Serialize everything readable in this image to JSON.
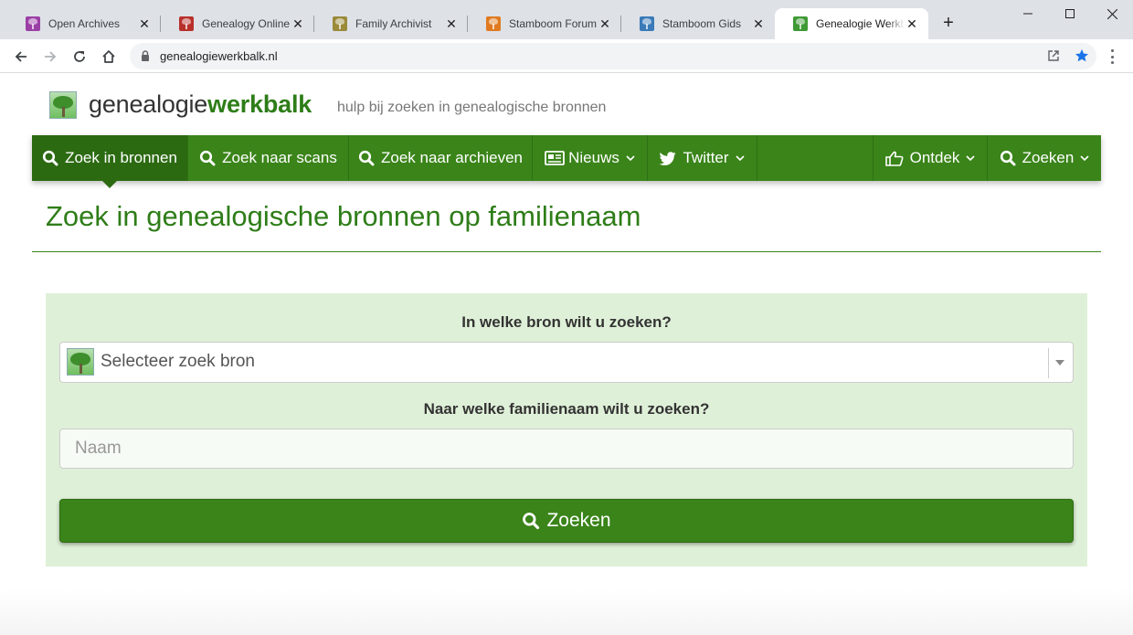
{
  "browser": {
    "tabs": [
      {
        "title": "Open Archives",
        "favicon_color": "#9b3fa6",
        "active": false
      },
      {
        "title": "Genealogy Online",
        "favicon_color": "#b8302a",
        "active": false
      },
      {
        "title": "Family Archivist",
        "favicon_color": "#9a8a3a",
        "active": false
      },
      {
        "title": "Stamboom Forum",
        "favicon_color": "#e07a20",
        "active": false
      },
      {
        "title": "Stamboom Gids",
        "favicon_color": "#3a7ab8",
        "active": false
      },
      {
        "title": "Genealogie Werkbalk",
        "favicon_color": "#3f9a35",
        "active": true
      }
    ],
    "url": "genealogiewerkbalk.nl",
    "accent_color": "#1a73e8"
  },
  "site": {
    "brand_plain": "genealogie",
    "brand_bold": "werkbalk",
    "tagline": "hulp bij zoeken in genealogische bronnen"
  },
  "nav": {
    "items": [
      {
        "label": "Zoek in bronnen",
        "icon": "search-icon",
        "active": true
      },
      {
        "label": "Zoek naar scans",
        "icon": "search-icon"
      },
      {
        "label": "Zoek naar archieven",
        "icon": "search-icon"
      },
      {
        "label": "Nieuws",
        "icon": "newspaper-icon",
        "dropdown": true
      },
      {
        "label": "Twitter",
        "icon": "twitter-icon",
        "dropdown": true
      },
      {
        "label": "Ontdek",
        "icon": "thumbs-up-icon",
        "dropdown": true
      },
      {
        "label": "Zoeken",
        "icon": "search-icon",
        "dropdown": true
      }
    ],
    "color": "#3a8419"
  },
  "main": {
    "title": "Zoek in genealogische bronnen op familienaam",
    "form": {
      "source_label": "In welke bron wilt u zoeken?",
      "source_select_placeholder": "Selecteer zoek bron",
      "name_label": "Naar welke familienaam wilt u zoeken?",
      "name_placeholder": "Naam",
      "name_value": "",
      "submit_label": "Zoeken"
    },
    "panel_color": "#dff0d8"
  }
}
